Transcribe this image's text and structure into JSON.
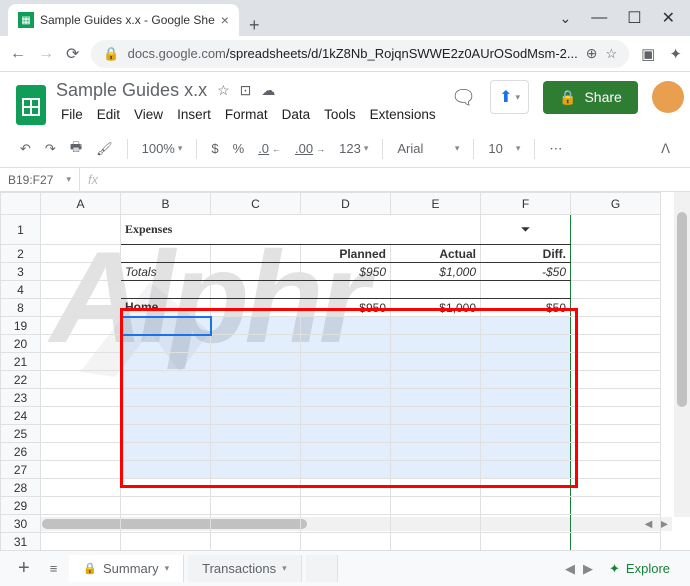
{
  "browser": {
    "tab_title": "Sample Guides x.x - Google She",
    "url_host": "docs.google.com",
    "url_path": "/spreadsheets/d/1kZ8Nb_RojqnSWWE2z0AUrOSodMsm-2..."
  },
  "doc": {
    "title": "Sample Guides x.x",
    "menus": [
      "File",
      "Edit",
      "View",
      "Insert",
      "Format",
      "Data",
      "Tools",
      "Extensions"
    ],
    "share_label": "Share"
  },
  "toolbar": {
    "zoom": "100%",
    "currency": "$",
    "percent": "%",
    "dec_dec": ".0",
    "dec_inc": ".00",
    "format": "123",
    "font": "Arial",
    "size": "10"
  },
  "namebox": "B19:F27",
  "sheet": {
    "col_headers": [
      "A",
      "B",
      "C",
      "D",
      "E",
      "F",
      "G"
    ],
    "row_labels": [
      "1",
      "2",
      "3",
      "4",
      "8",
      "19",
      "20",
      "21",
      "22",
      "23",
      "24",
      "25",
      "26",
      "27",
      "28",
      "29",
      "30",
      "31"
    ],
    "heading": "Expenses",
    "headers": {
      "planned": "Planned",
      "actual": "Actual",
      "diff": "Diff."
    },
    "totals": {
      "label": "Totals",
      "planned": "$950",
      "actual": "$1,000",
      "diff": "-$50"
    },
    "row_home": {
      "label": "Home",
      "planned": "$950",
      "actual": "$1,000",
      "diff": "-$50"
    }
  },
  "tabs": {
    "summary": "Summary",
    "transactions": "Transactions",
    "explore": "Explore"
  }
}
